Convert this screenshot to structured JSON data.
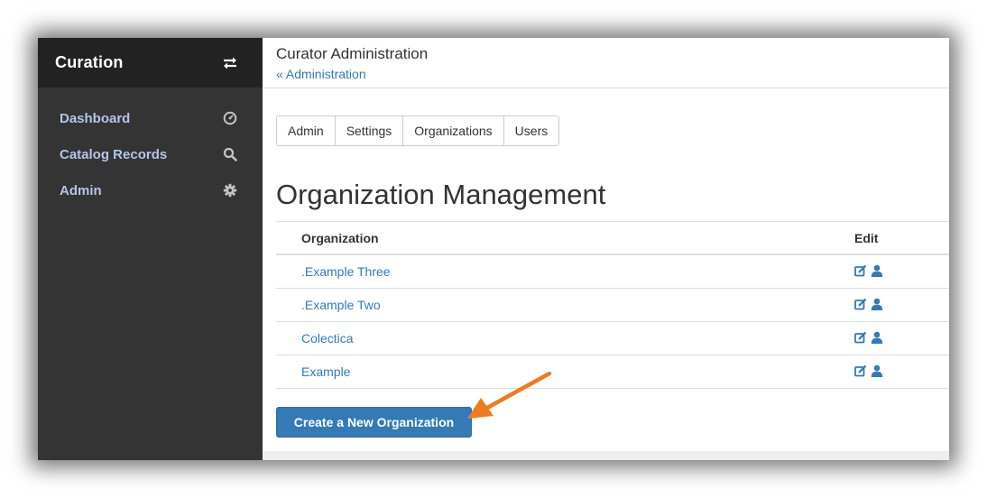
{
  "sidebar": {
    "brand": "Curation",
    "items": [
      {
        "label": "Dashboard",
        "icon": "dashboard-icon"
      },
      {
        "label": "Catalog Records",
        "icon": "search-icon"
      },
      {
        "label": "Admin",
        "icon": "gear-icon"
      }
    ]
  },
  "header": {
    "title": "Curator Administration",
    "breadcrumb": "« Administration"
  },
  "tabs": [
    "Admin",
    "Settings",
    "Organizations",
    "Users"
  ],
  "page": {
    "title": "Organization Management"
  },
  "table": {
    "columns": [
      "Organization",
      "Edit"
    ],
    "rows": [
      {
        "name": ".Example Three"
      },
      {
        "name": ".Example Two"
      },
      {
        "name": "Colectica"
      },
      {
        "name": "Example"
      }
    ]
  },
  "actions": {
    "create_label": "Create a New Organization"
  },
  "colors": {
    "sidebar_bg": "#343434",
    "brand_bg": "#222222",
    "link": "#337ab7",
    "button": "#337ab7",
    "annotation_arrow": "#f07b1e"
  }
}
